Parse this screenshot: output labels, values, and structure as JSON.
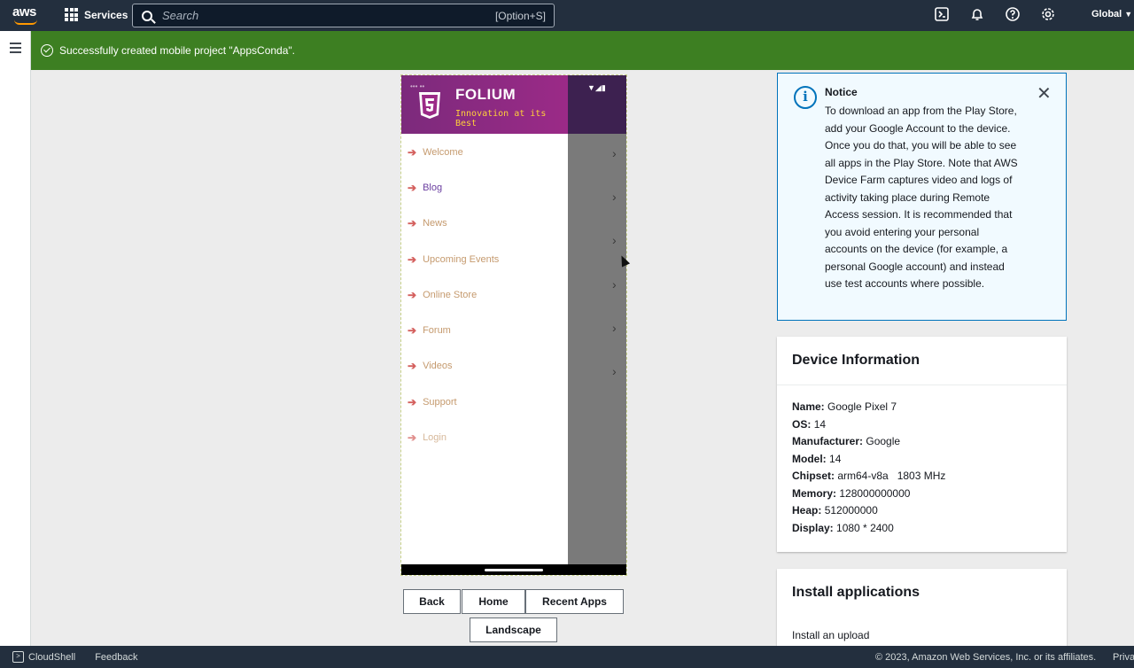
{
  "topnav": {
    "logo": "aws",
    "services_label": "Services",
    "search_placeholder": "Search",
    "search_shortcut": "[Option+S]",
    "region": "Global",
    "icons": [
      "cloudshell-icon",
      "bell-icon",
      "help-icon",
      "gear-icon"
    ]
  },
  "flash": {
    "message": "Successfully created mobile project \"AppsConda\"."
  },
  "phone": {
    "app_name": "FOLIUM",
    "tagline": "Innovation at its Best",
    "menu": [
      {
        "label": "Welcome"
      },
      {
        "label": "Blog"
      },
      {
        "label": "News"
      },
      {
        "label": "Upcoming Events"
      },
      {
        "label": "Online Store"
      },
      {
        "label": "Forum"
      },
      {
        "label": "Videos"
      },
      {
        "label": "Support"
      },
      {
        "label": "Login"
      }
    ]
  },
  "device_buttons": {
    "back": "Back",
    "home": "Home",
    "recent": "Recent Apps",
    "landscape": "Landscape"
  },
  "notice": {
    "title": "Notice",
    "body": "To download an app from the Play Store, add your Google Account to the device. Once you do that, you will be able to see all apps in the Play Store. Note that AWS Device Farm captures video and logs of activity taking place during Remote Access session. It is recommended that you avoid entering your personal accounts on the device (for example, a personal Google account) and instead use test accounts where possible."
  },
  "device_info": {
    "title": "Device Information",
    "fields": [
      {
        "label": "Name:",
        "value": "Google Pixel 7"
      },
      {
        "label": "OS:",
        "value": "14"
      },
      {
        "label": "Manufacturer:",
        "value": "Google"
      },
      {
        "label": "Model:",
        "value": "14"
      },
      {
        "label": "Chipset:",
        "value": "arm64-v8a   1803 MHz"
      },
      {
        "label": "Memory:",
        "value": "128000000000"
      },
      {
        "label": "Heap:",
        "value": "512000000"
      },
      {
        "label": "Display:",
        "value": "1080 * 2400"
      }
    ]
  },
  "install": {
    "title": "Install applications",
    "subtitle": "Install an upload"
  },
  "footer": {
    "cloudshell": "CloudShell",
    "feedback": "Feedback",
    "copyright": "© 2023, Amazon Web Services, Inc. or its affiliates.",
    "privacy": "Privacy"
  }
}
